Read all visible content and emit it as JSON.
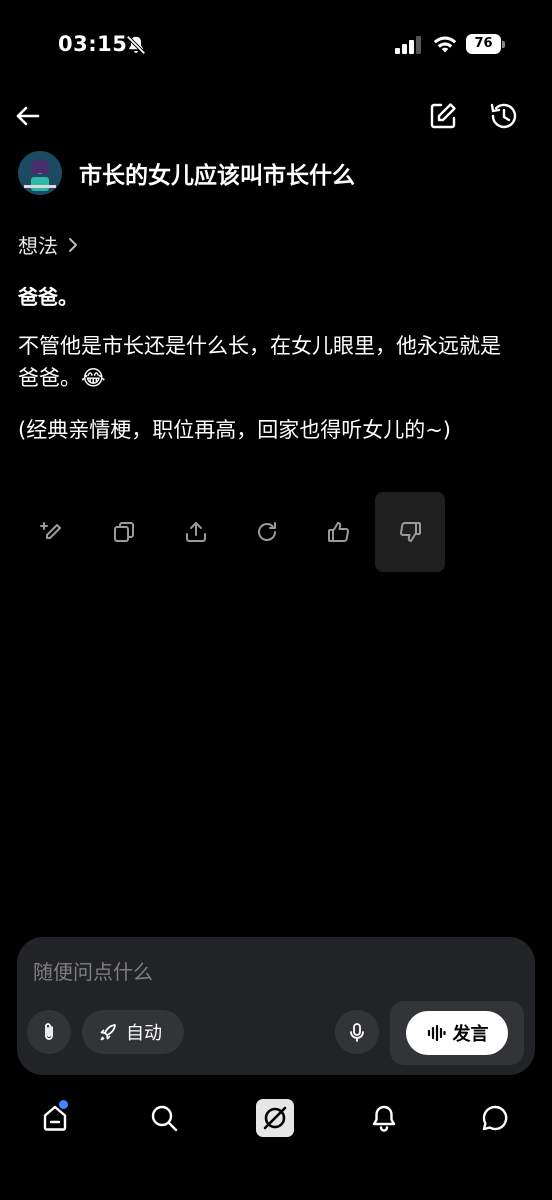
{
  "status_bar": {
    "time": "03:15",
    "battery": "76"
  },
  "conversation": {
    "title": "市长的女儿应该叫市长什么",
    "thoughts_label": "想法",
    "answer_heading": "爸爸。",
    "answer_paragraph_1": "不管他是市长还是什么长，在女儿眼里，他永远就是爸爸。😂",
    "answer_paragraph_2": "(经典亲情梗，职位再高，回家也得听女儿的~)"
  },
  "input": {
    "placeholder": "随便问点什么",
    "auto_label": "自动",
    "speak_label": "发言"
  },
  "colors": {
    "accent_dot": "#3d8bff",
    "input_bg": "#222326"
  }
}
